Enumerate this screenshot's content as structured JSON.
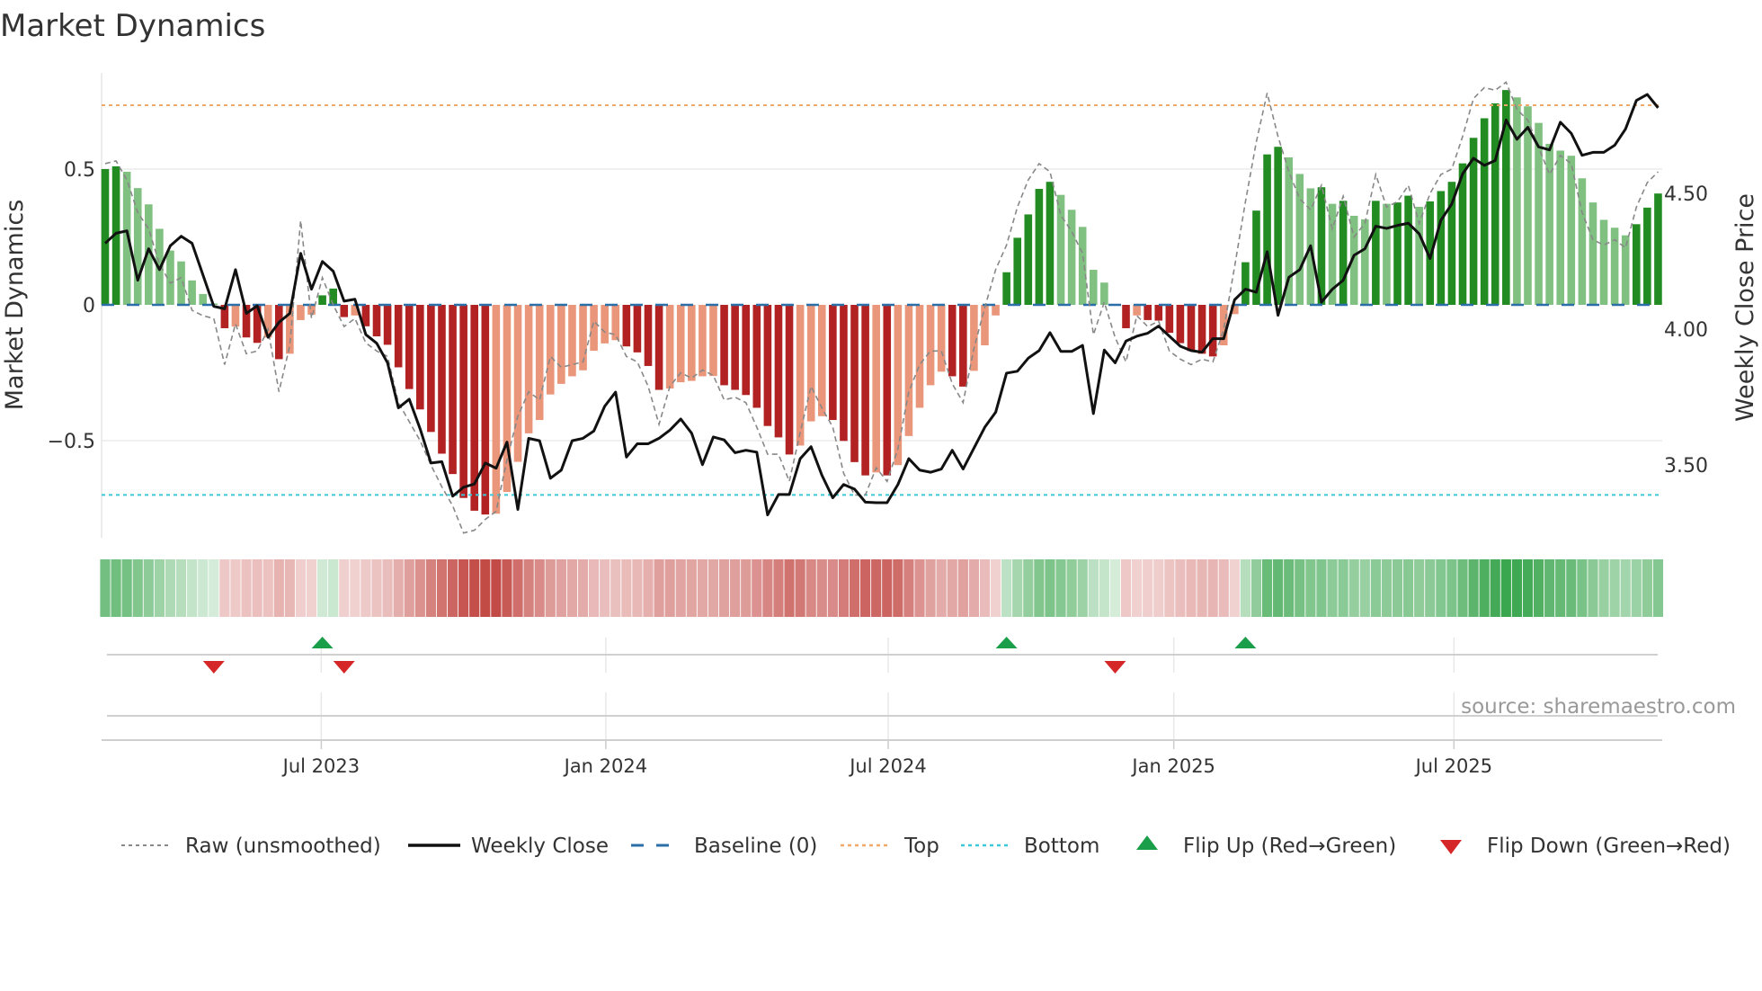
{
  "chart_data": {
    "type": "bar",
    "title": "Market Dynamics",
    "ylabel": "Market Dynamics",
    "y2label": "Weekly Close Price",
    "ylim": [
      -0.86,
      0.86
    ],
    "y2lim": [
      3.146,
      4.854
    ],
    "yticks": [
      {
        "v": 0.5,
        "label": "0.5"
      },
      {
        "v": 0,
        "label": "0"
      },
      {
        "v": -0.5,
        "label": "−0.5"
      }
    ],
    "y2ticks": [
      {
        "v": 4.5,
        "label": "4.50"
      },
      {
        "v": 4.0,
        "label": "4.00"
      },
      {
        "v": 3.5,
        "label": "3.50"
      }
    ],
    "x_unit": "week index",
    "xticks": [
      {
        "week": 19.9,
        "label": "Jul 2023"
      },
      {
        "week": 46.1,
        "label": "Jan 2024"
      },
      {
        "week": 72.1,
        "label": "Jul 2024"
      },
      {
        "week": 98.4,
        "label": "Jan 2025"
      },
      {
        "week": 124.2,
        "label": "Jul 2025"
      }
    ],
    "top_level": 0.735,
    "bottom_level": -0.7,
    "baseline": 0,
    "colors": {
      "up_strong": "#228b22",
      "up_weak": "#80c080",
      "down_strong": "#b22222",
      "down_weak": "#e9967a",
      "close": "#111111",
      "raw": "#888888",
      "baseline": "#2b6ea8",
      "top": "#f0a868",
      "bottom": "#3cc8d8",
      "flip_up": "#1a9e4a",
      "flip_down": "#d62728"
    },
    "series": [
      {
        "name": "Market Dynamics (smoothed)",
        "values": [
          0.5,
          0.51,
          0.49,
          0.43,
          0.37,
          0.28,
          0.2,
          0.16,
          0.09,
          0.04,
          0.005,
          -0.086,
          -0.08,
          -0.12,
          -0.14,
          -0.12,
          -0.2,
          -0.18,
          -0.056,
          -0.036,
          0.035,
          0.06,
          -0.045,
          -0.039,
          -0.079,
          -0.116,
          -0.147,
          -0.23,
          -0.31,
          -0.385,
          -0.468,
          -0.548,
          -0.623,
          -0.711,
          -0.758,
          -0.772,
          -0.769,
          -0.689,
          -0.578,
          -0.473,
          -0.424,
          -0.33,
          -0.291,
          -0.263,
          -0.241,
          -0.169,
          -0.142,
          -0.13,
          -0.153,
          -0.175,
          -0.225,
          -0.313,
          -0.308,
          -0.285,
          -0.28,
          -0.263,
          -0.262,
          -0.296,
          -0.313,
          -0.332,
          -0.379,
          -0.446,
          -0.488,
          -0.551,
          -0.518,
          -0.429,
          -0.41,
          -0.424,
          -0.501,
          -0.579,
          -0.628,
          -0.617,
          -0.628,
          -0.59,
          -0.483,
          -0.379,
          -0.296,
          -0.246,
          -0.263,
          -0.301,
          -0.243,
          -0.149,
          -0.039,
          0.12,
          0.247,
          0.333,
          0.427,
          0.453,
          0.405,
          0.35,
          0.287,
          0.129,
          0.082,
          0.0,
          -0.086,
          -0.039,
          -0.056,
          -0.058,
          -0.103,
          -0.141,
          -0.17,
          -0.18,
          -0.19,
          -0.149,
          -0.034,
          0.157,
          0.347,
          0.554,
          0.582,
          0.543,
          0.482,
          0.429,
          0.433,
          0.372,
          0.383,
          0.328,
          0.315,
          0.383,
          0.372,
          0.377,
          0.402,
          0.361,
          0.381,
          0.419,
          0.453,
          0.521,
          0.615,
          0.687,
          0.742,
          0.791,
          0.764,
          0.731,
          0.67,
          0.593,
          0.568,
          0.549,
          0.466,
          0.377,
          0.313,
          0.284,
          0.256,
          0.297,
          0.358,
          0.41
        ]
      },
      {
        "name": "Raw (unsmoothed)",
        "values": [
          0.52,
          0.53,
          0.46,
          0.34,
          0.28,
          0.15,
          0.08,
          0.1,
          -0.02,
          -0.04,
          -0.05,
          -0.22,
          -0.07,
          -0.18,
          -0.17,
          -0.09,
          -0.32,
          -0.15,
          0.31,
          -0.05,
          0.1,
          0.0,
          -0.08,
          -0.05,
          -0.14,
          -0.17,
          -0.19,
          -0.36,
          -0.43,
          -0.5,
          -0.59,
          -0.67,
          -0.74,
          -0.84,
          -0.83,
          -0.79,
          -0.76,
          -0.57,
          -0.41,
          -0.32,
          -0.35,
          -0.19,
          -0.23,
          -0.22,
          -0.21,
          -0.06,
          -0.1,
          -0.11,
          -0.19,
          -0.21,
          -0.3,
          -0.44,
          -0.3,
          -0.25,
          -0.27,
          -0.24,
          -0.26,
          -0.35,
          -0.34,
          -0.36,
          -0.45,
          -0.55,
          -0.55,
          -0.65,
          -0.47,
          -0.3,
          -0.38,
          -0.45,
          -0.62,
          -0.7,
          -0.7,
          -0.6,
          -0.65,
          -0.53,
          -0.32,
          -0.22,
          -0.17,
          -0.17,
          -0.29,
          -0.36,
          -0.16,
          -0.01,
          0.13,
          0.22,
          0.36,
          0.46,
          0.52,
          0.49,
          0.33,
          0.27,
          0.19,
          -0.11,
          0.01,
          -0.12,
          -0.21,
          -0.04,
          -0.08,
          -0.06,
          -0.17,
          -0.2,
          -0.22,
          -0.2,
          -0.21,
          -0.09,
          0.14,
          0.38,
          0.6,
          0.78,
          0.62,
          0.49,
          0.39,
          0.35,
          0.44,
          0.28,
          0.4,
          0.25,
          0.3,
          0.48,
          0.36,
          0.38,
          0.44,
          0.3,
          0.41,
          0.48,
          0.5,
          0.62,
          0.76,
          0.8,
          0.79,
          0.82,
          0.72,
          0.68,
          0.58,
          0.48,
          0.55,
          0.52,
          0.34,
          0.24,
          0.22,
          0.24,
          0.21,
          0.36,
          0.45,
          0.49
        ]
      },
      {
        "name": "Weekly Close",
        "axis": "right",
        "values": [
          4.316,
          4.353,
          4.362,
          4.18,
          4.296,
          4.219,
          4.307,
          4.342,
          4.316,
          4.2,
          4.084,
          4.075,
          4.219,
          4.058,
          4.086,
          3.97,
          4.025,
          4.058,
          4.279,
          4.147,
          4.249,
          4.213,
          4.103,
          4.11,
          3.98,
          3.948,
          3.876,
          3.71,
          3.742,
          3.633,
          3.507,
          3.512,
          3.385,
          3.418,
          3.43,
          3.507,
          3.488,
          3.584,
          3.336,
          3.598,
          3.589,
          3.451,
          3.481,
          3.589,
          3.598,
          3.625,
          3.716,
          3.768,
          3.529,
          3.578,
          3.578,
          3.598,
          3.628,
          3.669,
          3.617,
          3.501,
          3.603,
          3.592,
          3.545,
          3.554,
          3.547,
          3.316,
          3.391,
          3.391,
          3.523,
          3.567,
          3.462,
          3.379,
          3.428,
          3.411,
          3.363,
          3.361,
          3.361,
          3.428,
          3.523,
          3.481,
          3.473,
          3.485,
          3.554,
          3.485,
          3.562,
          3.639,
          3.694,
          3.838,
          3.845,
          3.893,
          3.921,
          3.987,
          3.918,
          3.918,
          3.94,
          3.689,
          3.923,
          3.876,
          3.956,
          3.974,
          3.985,
          4.011,
          3.974,
          3.937,
          3.921,
          3.915,
          3.965,
          3.965,
          4.108,
          4.147,
          4.136,
          4.285,
          4.051,
          4.191,
          4.219,
          4.307,
          4.099,
          4.147,
          4.18,
          4.272,
          4.296,
          4.379,
          4.371,
          4.382,
          4.39,
          4.351,
          4.26,
          4.401,
          4.461,
          4.572,
          4.629,
          4.603,
          4.621,
          4.77,
          4.699,
          4.743,
          4.671,
          4.66,
          4.762,
          4.721,
          4.64,
          4.651,
          4.651,
          4.677,
          4.737,
          4.842,
          4.864,
          4.815
        ]
      }
    ],
    "flips": [
      {
        "week": 10,
        "type": "down"
      },
      {
        "week": 20,
        "type": "up"
      },
      {
        "week": 22,
        "type": "down"
      },
      {
        "week": 83,
        "type": "up"
      },
      {
        "week": 93,
        "type": "down"
      },
      {
        "week": 105,
        "type": "up"
      }
    ],
    "legend": {
      "placement": "bottom",
      "items": [
        {
          "key": "raw",
          "label": "Raw (unsmoothed)"
        },
        {
          "key": "close",
          "label": "Weekly Close"
        },
        {
          "key": "baseline",
          "label": "Baseline (0)"
        },
        {
          "key": "top",
          "label": "Top"
        },
        {
          "key": "bottom",
          "label": "Bottom"
        },
        {
          "key": "flip_up",
          "label": "Flip Up (Red→Green)"
        },
        {
          "key": "flip_down",
          "label": "Flip Down (Green→Red)"
        }
      ]
    },
    "source": "source: sharemaestro.com"
  }
}
